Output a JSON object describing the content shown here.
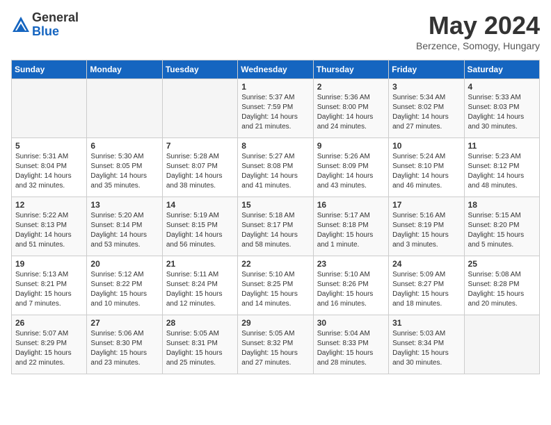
{
  "header": {
    "logo_general": "General",
    "logo_blue": "Blue",
    "month_title": "May 2024",
    "location": "Berzence, Somogy, Hungary"
  },
  "days_of_week": [
    "Sunday",
    "Monday",
    "Tuesday",
    "Wednesday",
    "Thursday",
    "Friday",
    "Saturday"
  ],
  "weeks": [
    [
      {
        "day": "",
        "info": ""
      },
      {
        "day": "",
        "info": ""
      },
      {
        "day": "",
        "info": ""
      },
      {
        "day": "1",
        "info": "Sunrise: 5:37 AM\nSunset: 7:59 PM\nDaylight: 14 hours\nand 21 minutes."
      },
      {
        "day": "2",
        "info": "Sunrise: 5:36 AM\nSunset: 8:00 PM\nDaylight: 14 hours\nand 24 minutes."
      },
      {
        "day": "3",
        "info": "Sunrise: 5:34 AM\nSunset: 8:02 PM\nDaylight: 14 hours\nand 27 minutes."
      },
      {
        "day": "4",
        "info": "Sunrise: 5:33 AM\nSunset: 8:03 PM\nDaylight: 14 hours\nand 30 minutes."
      }
    ],
    [
      {
        "day": "5",
        "info": "Sunrise: 5:31 AM\nSunset: 8:04 PM\nDaylight: 14 hours\nand 32 minutes."
      },
      {
        "day": "6",
        "info": "Sunrise: 5:30 AM\nSunset: 8:05 PM\nDaylight: 14 hours\nand 35 minutes."
      },
      {
        "day": "7",
        "info": "Sunrise: 5:28 AM\nSunset: 8:07 PM\nDaylight: 14 hours\nand 38 minutes."
      },
      {
        "day": "8",
        "info": "Sunrise: 5:27 AM\nSunset: 8:08 PM\nDaylight: 14 hours\nand 41 minutes."
      },
      {
        "day": "9",
        "info": "Sunrise: 5:26 AM\nSunset: 8:09 PM\nDaylight: 14 hours\nand 43 minutes."
      },
      {
        "day": "10",
        "info": "Sunrise: 5:24 AM\nSunset: 8:10 PM\nDaylight: 14 hours\nand 46 minutes."
      },
      {
        "day": "11",
        "info": "Sunrise: 5:23 AM\nSunset: 8:12 PM\nDaylight: 14 hours\nand 48 minutes."
      }
    ],
    [
      {
        "day": "12",
        "info": "Sunrise: 5:22 AM\nSunset: 8:13 PM\nDaylight: 14 hours\nand 51 minutes."
      },
      {
        "day": "13",
        "info": "Sunrise: 5:20 AM\nSunset: 8:14 PM\nDaylight: 14 hours\nand 53 minutes."
      },
      {
        "day": "14",
        "info": "Sunrise: 5:19 AM\nSunset: 8:15 PM\nDaylight: 14 hours\nand 56 minutes."
      },
      {
        "day": "15",
        "info": "Sunrise: 5:18 AM\nSunset: 8:17 PM\nDaylight: 14 hours\nand 58 minutes."
      },
      {
        "day": "16",
        "info": "Sunrise: 5:17 AM\nSunset: 8:18 PM\nDaylight: 15 hours\nand 1 minute."
      },
      {
        "day": "17",
        "info": "Sunrise: 5:16 AM\nSunset: 8:19 PM\nDaylight: 15 hours\nand 3 minutes."
      },
      {
        "day": "18",
        "info": "Sunrise: 5:15 AM\nSunset: 8:20 PM\nDaylight: 15 hours\nand 5 minutes."
      }
    ],
    [
      {
        "day": "19",
        "info": "Sunrise: 5:13 AM\nSunset: 8:21 PM\nDaylight: 15 hours\nand 7 minutes."
      },
      {
        "day": "20",
        "info": "Sunrise: 5:12 AM\nSunset: 8:22 PM\nDaylight: 15 hours\nand 10 minutes."
      },
      {
        "day": "21",
        "info": "Sunrise: 5:11 AM\nSunset: 8:24 PM\nDaylight: 15 hours\nand 12 minutes."
      },
      {
        "day": "22",
        "info": "Sunrise: 5:10 AM\nSunset: 8:25 PM\nDaylight: 15 hours\nand 14 minutes."
      },
      {
        "day": "23",
        "info": "Sunrise: 5:10 AM\nSunset: 8:26 PM\nDaylight: 15 hours\nand 16 minutes."
      },
      {
        "day": "24",
        "info": "Sunrise: 5:09 AM\nSunset: 8:27 PM\nDaylight: 15 hours\nand 18 minutes."
      },
      {
        "day": "25",
        "info": "Sunrise: 5:08 AM\nSunset: 8:28 PM\nDaylight: 15 hours\nand 20 minutes."
      }
    ],
    [
      {
        "day": "26",
        "info": "Sunrise: 5:07 AM\nSunset: 8:29 PM\nDaylight: 15 hours\nand 22 minutes."
      },
      {
        "day": "27",
        "info": "Sunrise: 5:06 AM\nSunset: 8:30 PM\nDaylight: 15 hours\nand 23 minutes."
      },
      {
        "day": "28",
        "info": "Sunrise: 5:05 AM\nSunset: 8:31 PM\nDaylight: 15 hours\nand 25 minutes."
      },
      {
        "day": "29",
        "info": "Sunrise: 5:05 AM\nSunset: 8:32 PM\nDaylight: 15 hours\nand 27 minutes."
      },
      {
        "day": "30",
        "info": "Sunrise: 5:04 AM\nSunset: 8:33 PM\nDaylight: 15 hours\nand 28 minutes."
      },
      {
        "day": "31",
        "info": "Sunrise: 5:03 AM\nSunset: 8:34 PM\nDaylight: 15 hours\nand 30 minutes."
      },
      {
        "day": "",
        "info": ""
      }
    ]
  ]
}
